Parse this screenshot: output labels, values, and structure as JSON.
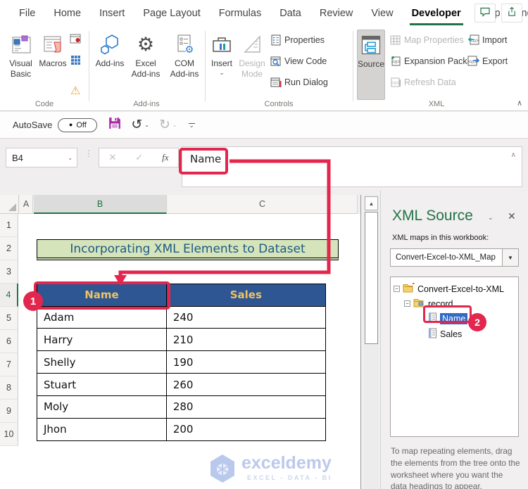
{
  "titlebar": {
    "tabs": [
      "File",
      "Home",
      "Insert",
      "Page Layout",
      "Formulas",
      "Data",
      "Review",
      "View",
      "Developer",
      "Help",
      "Inquire"
    ],
    "active_tab": "Developer"
  },
  "ribbon": {
    "code": {
      "visual_basic": "Visual Basic",
      "macros": "Macros",
      "label": "Code"
    },
    "addins": {
      "addins": "Add-ins",
      "excel_addins": "Excel Add-ins",
      "com_addins": "COM Add-ins",
      "label": "Add-ins"
    },
    "controls": {
      "insert": "Insert",
      "design_mode": "Design Mode",
      "properties": "Properties",
      "view_code": "View Code",
      "run_dialog": "Run Dialog",
      "label": "Controls"
    },
    "xml": {
      "source": "Source",
      "map_properties": "Map Properties",
      "expansion_packs": "Expansion Packs",
      "refresh_data": "Refresh Data",
      "import": "Import",
      "export": "Export",
      "label": "XML"
    }
  },
  "quick_access": {
    "autosave_label": "AutoSave",
    "autosave_state": "Off"
  },
  "formula_bar": {
    "name_box": "B4",
    "content": "Name"
  },
  "sheet": {
    "columns": [
      "A",
      "B",
      "C"
    ],
    "rows": [
      "1",
      "2",
      "3",
      "4",
      "5",
      "6",
      "7",
      "8",
      "9",
      "10"
    ],
    "title": "Incorporating XML Elements to Dataset",
    "table": {
      "headers": [
        "Name",
        "Sales"
      ],
      "rows": [
        [
          "Adam",
          "240"
        ],
        [
          "Harry",
          "210"
        ],
        [
          "Shelly",
          "190"
        ],
        [
          "Stuart",
          "260"
        ],
        [
          "Moly",
          "280"
        ],
        [
          "Jhon",
          "200"
        ]
      ]
    }
  },
  "xml_pane": {
    "title": "XML Source",
    "maps_label": "XML maps in this workbook:",
    "map_dropdown": "Convert-Excel-to-XML_Map",
    "tree": {
      "root": "Convert-Excel-to-XML",
      "record": "record",
      "name": "Name",
      "sales": "Sales"
    },
    "helper_text": "To map repeating elements, drag the elements from the tree onto the worksheet where you want the data headings to appear."
  },
  "annotations": {
    "badge1": "1",
    "badge2": "2"
  },
  "watermark": {
    "brand": "exceldemy",
    "tagline": "EXCEL - DATA - BI"
  },
  "icons": {
    "dropdown": "▼",
    "dropdown_small": "⌄",
    "close": "✕",
    "collapse_chevron": "∧",
    "undo": "↺",
    "redo": "↻",
    "warning": "⚠",
    "autosave_dot": "●",
    "up_arrow": "▲",
    "cancel": "✕",
    "enter": "✓",
    "fx": "fx",
    "tree_collapse": "−",
    "gear": "⚙",
    "dots": "⋮"
  },
  "colors": {
    "accent_green": "#217346",
    "annotation_red": "#e2264d",
    "table_header_blue": "#2e5693",
    "table_header_gold": "#efc264",
    "title_fill": "#d6e4bc",
    "title_text": "#1e5a83",
    "tree_selection_blue": "#2f6bc7"
  }
}
